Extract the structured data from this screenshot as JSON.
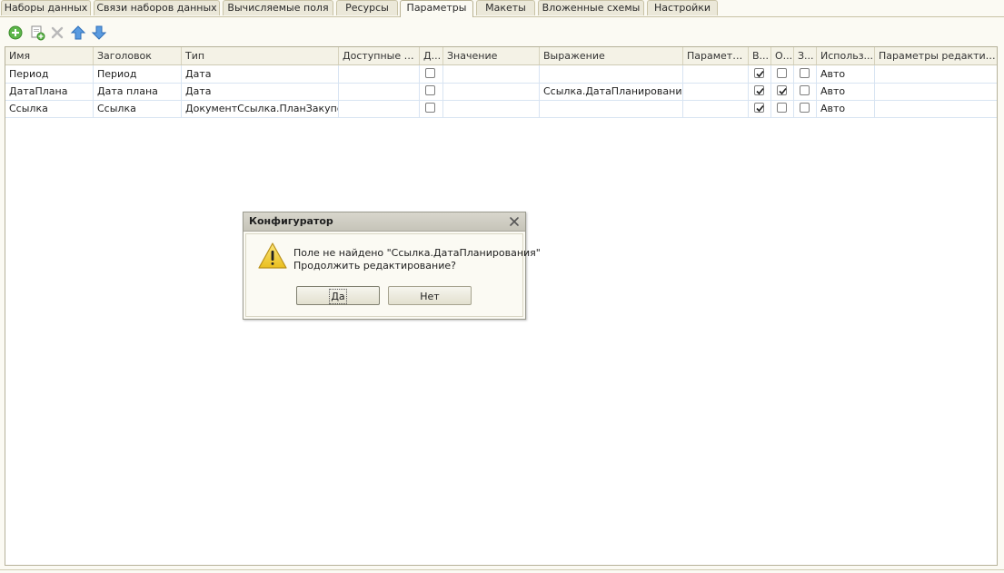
{
  "tabs": [
    {
      "label": "Наборы данных",
      "active": false
    },
    {
      "label": "Связи наборов данных",
      "active": false
    },
    {
      "label": "Вычисляемые поля",
      "active": false
    },
    {
      "label": "Ресурсы",
      "active": false
    },
    {
      "label": "Параметры",
      "active": true
    },
    {
      "label": "Макеты",
      "active": false
    },
    {
      "label": "Вложенные схемы",
      "active": false
    },
    {
      "label": "Настройки",
      "active": false
    }
  ],
  "toolbar": {
    "icons": [
      "add-icon",
      "copy-add-icon",
      "delete-icon",
      "move-up-icon",
      "move-down-icon"
    ]
  },
  "table": {
    "columns": [
      "Имя",
      "Заголовок",
      "Тип",
      "Доступные зн...",
      "Д...",
      "Значение",
      "Выражение",
      "Параметр ...",
      "В...",
      "О...",
      "З...",
      "Использ...",
      "Параметры редактиро..."
    ],
    "rows": [
      {
        "name": "Период",
        "title": "Период",
        "type": "Дата",
        "available": "",
        "d": false,
        "value": "",
        "expression": "",
        "param": "",
        "v": true,
        "o": false,
        "z": false,
        "use": "Авто",
        "edit_params": ""
      },
      {
        "name": "ДатаПлана",
        "title": "Дата плана",
        "type": "Дата",
        "available": "",
        "d": false,
        "value": "",
        "expression": "Ссылка.ДатаПланирования",
        "param": "",
        "v": true,
        "o": true,
        "z": false,
        "use": "Авто",
        "edit_params": ""
      },
      {
        "name": "Ссылка",
        "title": "Ссылка",
        "type": "ДокументСсылка.ПланЗакупок",
        "available": "",
        "d": false,
        "value": "",
        "expression": "",
        "param": "",
        "v": true,
        "o": false,
        "z": false,
        "use": "Авто",
        "edit_params": ""
      }
    ]
  },
  "dialog": {
    "title": "Конфигуратор",
    "message_line1": "Поле не найдено \"Ссылка.ДатаПланирования\"",
    "message_line2": "Продолжить редактирование?",
    "yes_label": "Да",
    "no_label": "Нет",
    "icon": "warning-icon"
  },
  "colors": {
    "background": "#fbfaf3",
    "tab_inactive": "#ebe8d9",
    "grid_line": "#d8e4f2",
    "warning_yellow": "#f5d34a"
  }
}
